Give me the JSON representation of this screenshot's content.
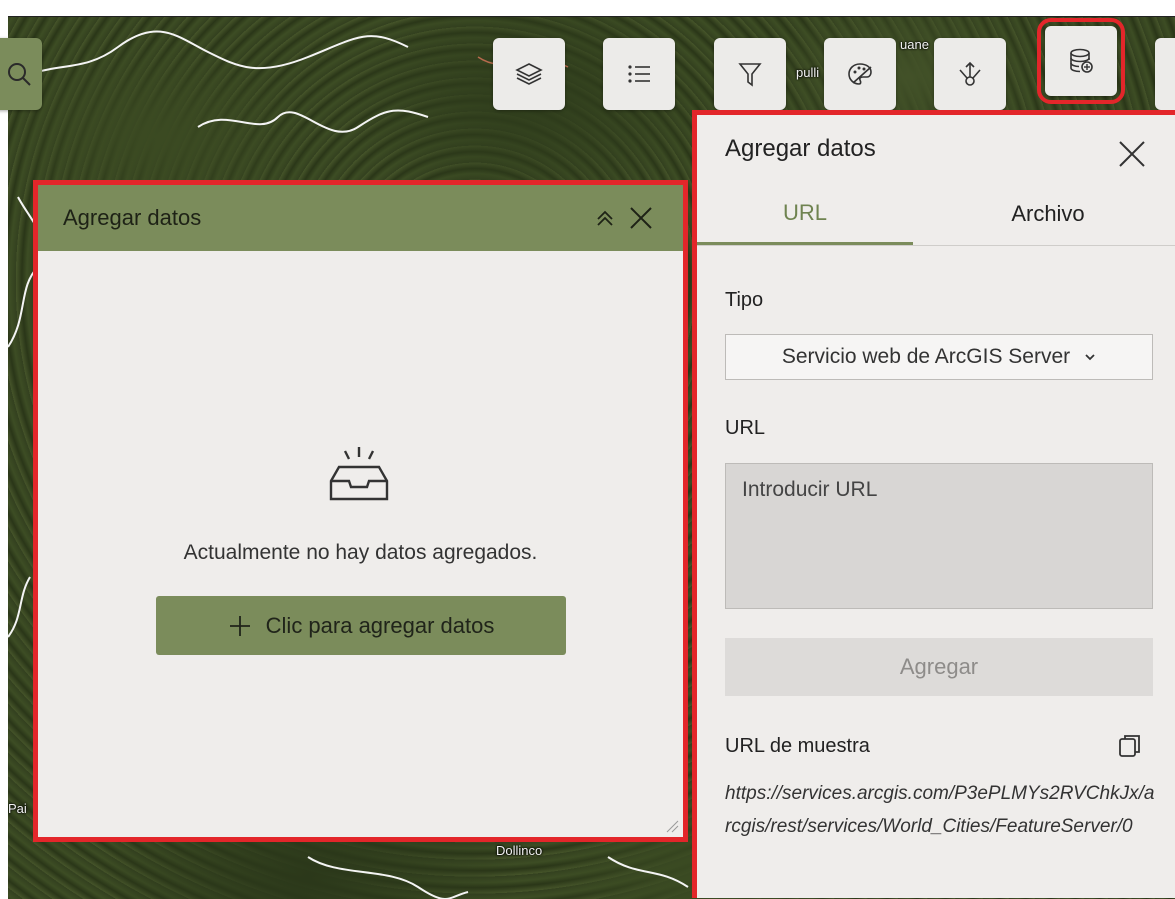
{
  "map": {
    "place_labels": [
      "pulli",
      "uane",
      "Pai",
      "Dollinco"
    ]
  },
  "toolbar": {
    "tools": [
      {
        "name": "search",
        "icon": "search-icon"
      },
      {
        "name": "layers",
        "icon": "layers-icon"
      },
      {
        "name": "legend",
        "icon": "list-icon"
      },
      {
        "name": "filter",
        "icon": "filter-icon"
      },
      {
        "name": "style",
        "icon": "palette-icon"
      },
      {
        "name": "share",
        "icon": "share-icon"
      },
      {
        "name": "add-data",
        "icon": "database-add-icon",
        "highlighted": true
      }
    ]
  },
  "left_panel": {
    "title": "Agregar datos",
    "empty_message": "Actualmente no hay datos agregados.",
    "add_button_label": "Clic para agregar datos"
  },
  "right_panel": {
    "title": "Agregar datos",
    "tabs": [
      {
        "label": "URL",
        "active": true
      },
      {
        "label": "Archivo",
        "active": false
      }
    ],
    "type_label": "Tipo",
    "type_selected": "Servicio web de ArcGIS Server",
    "url_label": "URL",
    "url_placeholder": "Introducir URL",
    "add_button_label": "Agregar",
    "sample_label": "URL de muestra",
    "sample_url": "https://services.arcgis.com/P3ePLMYs2RVChkJx/arcgis/rest/services/World_Cities/FeatureServer/0"
  },
  "colors": {
    "accent": "#7b8c5b",
    "highlight": "#e3262a",
    "panel_bg": "#efedeb"
  }
}
